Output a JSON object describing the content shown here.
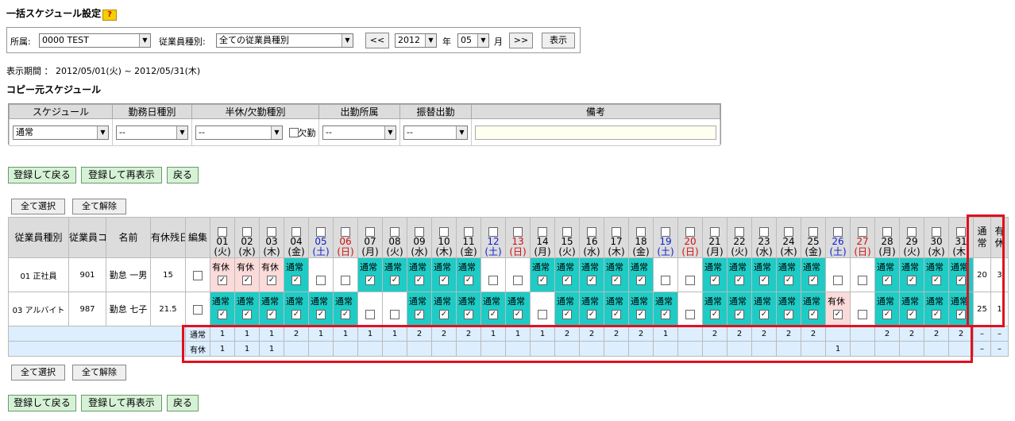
{
  "page": {
    "title": "一括スケジュール設定",
    "help": "?"
  },
  "filter": {
    "dept_label": "所属:",
    "dept_value": "0000 TEST",
    "type_label": "従業員種別:",
    "type_value": "全ての従業員種別",
    "prev": "<<",
    "year": "2012",
    "year_unit": "年",
    "month": "05",
    "month_unit": "月",
    "next": ">>",
    "show": "表示"
  },
  "period": "表示期間 ： 2012/05/01(火) ~ 2012/05/31(木)",
  "copy": {
    "title": "コピー元スケジュール",
    "headers": [
      "スケジュール",
      "勤務日種別",
      "半休/欠勤種別",
      "出勤所属",
      "振替出勤",
      "備考"
    ],
    "schedule": "通常",
    "daytype": "--",
    "halfday": "--",
    "absent_label": "欠勤",
    "dept": "--",
    "transfer": "--",
    "note": ""
  },
  "actions": {
    "save_back": "登録して戻る",
    "save_reload": "登録して再表示",
    "back": "戻る"
  },
  "select": {
    "all": "全て選択",
    "none": "全て解除"
  },
  "grid": {
    "headers": {
      "type": "従業員種別",
      "code": "従業員コード",
      "name": "名前",
      "leave": "有休残日数",
      "edit": "編集",
      "normal": "通常",
      "paid": "有休"
    },
    "days": [
      {
        "d": "01",
        "w": "(火)"
      },
      {
        "d": "02",
        "w": "(水)"
      },
      {
        "d": "03",
        "w": "(木)"
      },
      {
        "d": "04",
        "w": "(金)"
      },
      {
        "d": "05",
        "w": "(土)",
        "k": "sat"
      },
      {
        "d": "06",
        "w": "(日)",
        "k": "sun"
      },
      {
        "d": "07",
        "w": "(月)"
      },
      {
        "d": "08",
        "w": "(火)"
      },
      {
        "d": "09",
        "w": "(水)"
      },
      {
        "d": "10",
        "w": "(木)"
      },
      {
        "d": "11",
        "w": "(金)"
      },
      {
        "d": "12",
        "w": "(土)",
        "k": "sat"
      },
      {
        "d": "13",
        "w": "(日)",
        "k": "sun"
      },
      {
        "d": "14",
        "w": "(月)"
      },
      {
        "d": "15",
        "w": "(火)"
      },
      {
        "d": "16",
        "w": "(水)"
      },
      {
        "d": "17",
        "w": "(木)"
      },
      {
        "d": "18",
        "w": "(金)"
      },
      {
        "d": "19",
        "w": "(土)",
        "k": "sat"
      },
      {
        "d": "20",
        "w": "(日)",
        "k": "sun"
      },
      {
        "d": "21",
        "w": "(月)"
      },
      {
        "d": "22",
        "w": "(火)"
      },
      {
        "d": "23",
        "w": "(水)"
      },
      {
        "d": "24",
        "w": "(木)"
      },
      {
        "d": "25",
        "w": "(金)"
      },
      {
        "d": "26",
        "w": "(土)",
        "k": "sat"
      },
      {
        "d": "27",
        "w": "(日)",
        "k": "sun"
      },
      {
        "d": "28",
        "w": "(月)"
      },
      {
        "d": "29",
        "w": "(火)"
      },
      {
        "d": "30",
        "w": "(水)"
      },
      {
        "d": "31",
        "w": "(木)"
      }
    ],
    "rows": [
      {
        "type": "01 正社員",
        "code": "901",
        "name": "勤怠 一男",
        "leave": "15",
        "normal": "20",
        "paid": "3",
        "cells": [
          "P",
          "P",
          "P",
          "N",
          "E",
          "E",
          "N",
          "N",
          "N",
          "N",
          "N",
          "E",
          "E",
          "N",
          "N",
          "N",
          "N",
          "N",
          "E",
          "E",
          "N",
          "N",
          "N",
          "N",
          "N",
          "E",
          "E",
          "N",
          "N",
          "N",
          "N"
        ]
      },
      {
        "type": "03 アルバイト",
        "code": "987",
        "name": "勤怠 七子",
        "leave": "21.5",
        "normal": "25",
        "paid": "1",
        "cells": [
          "N",
          "N",
          "N",
          "N",
          "N",
          "N",
          "E",
          "E",
          "N",
          "N",
          "N",
          "N",
          "N",
          "E",
          "N",
          "N",
          "N",
          "N",
          "N",
          "E",
          "N",
          "N",
          "N",
          "N",
          "N",
          "P",
          "E",
          "N",
          "N",
          "N",
          "N"
        ]
      }
    ],
    "summary": {
      "normal_label": "通常",
      "paid_label": "有休",
      "normal": [
        "1",
        "1",
        "1",
        "2",
        "1",
        "1",
        "1",
        "1",
        "2",
        "2",
        "2",
        "1",
        "1",
        "1",
        "2",
        "2",
        "2",
        "2",
        "1",
        "",
        "2",
        "2",
        "2",
        "2",
        "2",
        "",
        "",
        "2",
        "2",
        "2",
        "2"
      ],
      "paid": [
        "1",
        "1",
        "1",
        "",
        "",
        "",
        "",
        "",
        "",
        "",
        "",
        "",
        "",
        "",
        "",
        "",
        "",
        "",
        "",
        "",
        "",
        "",
        "",
        "",
        "",
        "1",
        "",
        "",
        "",
        "",
        ""
      ],
      "dash": "–"
    }
  },
  "cell_labels": {
    "N": "通常",
    "P": "有休"
  },
  "colors": {
    "work": "#1ecbc5",
    "paid": "#fbdada",
    "highlight": "#e0101e"
  }
}
